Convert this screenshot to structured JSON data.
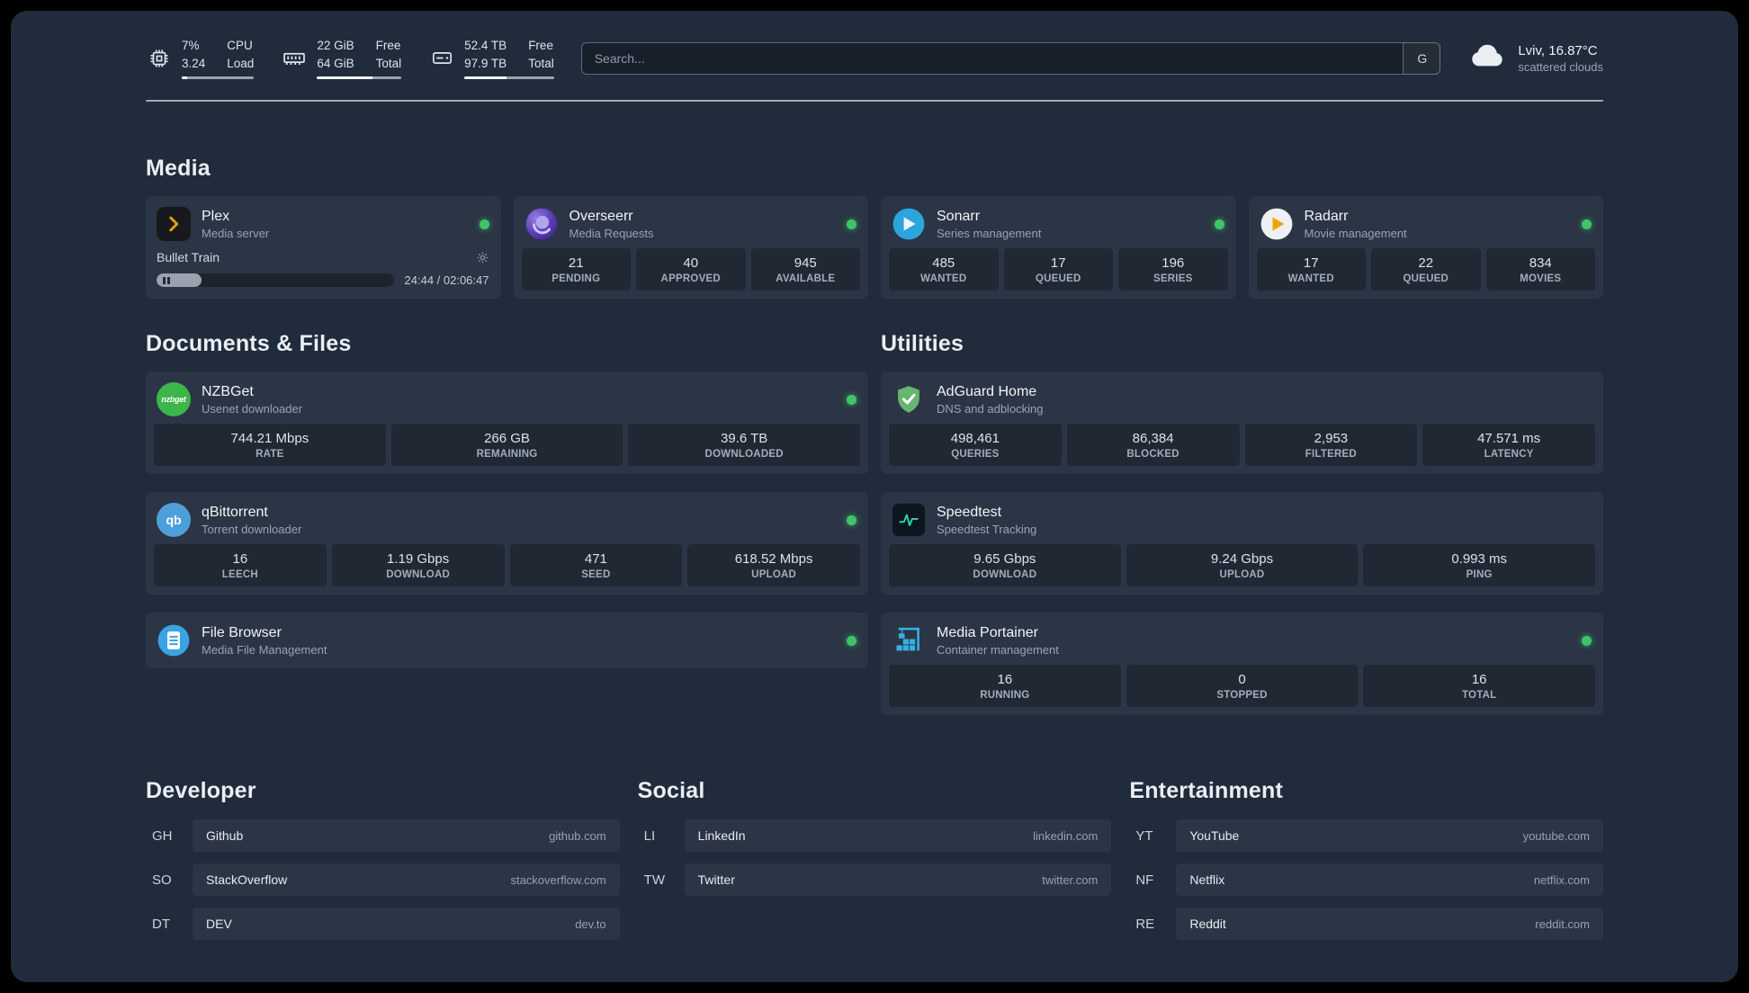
{
  "topbar": {
    "cpu": {
      "value_top": "7%",
      "value_bottom": "3.24",
      "label_top": "CPU",
      "label_bottom": "Load"
    },
    "memory": {
      "value_top": "22 GiB",
      "value_bottom": "64 GiB",
      "label_top": "Free",
      "label_bottom": "Total"
    },
    "disk": {
      "value_top": "52.4 TB",
      "value_bottom": "97.9 TB",
      "label_top": "Free",
      "label_bottom": "Total"
    },
    "search": {
      "placeholder": "Search...",
      "button_label": "G"
    },
    "weather": {
      "location": "Lviv, 16.87°C",
      "condition": "scattered clouds"
    }
  },
  "sections": {
    "media": {
      "title": "Media"
    },
    "documents": {
      "title": "Documents & Files"
    },
    "utilities": {
      "title": "Utilities"
    }
  },
  "services": {
    "plex": {
      "name": "Plex",
      "subtitle": "Media server",
      "player_title": "Bullet Train",
      "player_time": "24:44 / 02:06:47"
    },
    "overseerr": {
      "name": "Overseerr",
      "subtitle": "Media Requests",
      "stats": [
        {
          "value": "21",
          "label": "PENDING"
        },
        {
          "value": "40",
          "label": "APPROVED"
        },
        {
          "value": "945",
          "label": "AVAILABLE"
        }
      ]
    },
    "sonarr": {
      "name": "Sonarr",
      "subtitle": "Series management",
      "stats": [
        {
          "value": "485",
          "label": "WANTED"
        },
        {
          "value": "17",
          "label": "QUEUED"
        },
        {
          "value": "196",
          "label": "SERIES"
        }
      ]
    },
    "radarr": {
      "name": "Radarr",
      "subtitle": "Movie management",
      "stats": [
        {
          "value": "17",
          "label": "WANTED"
        },
        {
          "value": "22",
          "label": "QUEUED"
        },
        {
          "value": "834",
          "label": "MOVIES"
        }
      ]
    },
    "nzbget": {
      "name": "NZBGet",
      "subtitle": "Usenet downloader",
      "icon_text": "nzbget",
      "stats": [
        {
          "value": "744.21 Mbps",
          "label": "RATE"
        },
        {
          "value": "266 GB",
          "label": "REMAINING"
        },
        {
          "value": "39.6 TB",
          "label": "DOWNLOADED"
        }
      ]
    },
    "qbittorrent": {
      "name": "qBittorrent",
      "subtitle": "Torrent downloader",
      "icon_text": "qb",
      "stats": [
        {
          "value": "16",
          "label": "LEECH"
        },
        {
          "value": "1.19 Gbps",
          "label": "DOWNLOAD"
        },
        {
          "value": "471",
          "label": "SEED"
        },
        {
          "value": "618.52 Mbps",
          "label": "UPLOAD"
        }
      ]
    },
    "filebrowser": {
      "name": "File Browser",
      "subtitle": "Media File Management"
    },
    "adguard": {
      "name": "AdGuard Home",
      "subtitle": "DNS and adblocking",
      "stats": [
        {
          "value": "498,461",
          "label": "QUERIES"
        },
        {
          "value": "86,384",
          "label": "BLOCKED"
        },
        {
          "value": "2,953",
          "label": "FILTERED"
        },
        {
          "value": "47.571 ms",
          "label": "LATENCY"
        }
      ]
    },
    "speedtest": {
      "name": "Speedtest",
      "subtitle": "Speedtest Tracking",
      "stats": [
        {
          "value": "9.65 Gbps",
          "label": "DOWNLOAD"
        },
        {
          "value": "9.24 Gbps",
          "label": "UPLOAD"
        },
        {
          "value": "0.993 ms",
          "label": "PING"
        }
      ]
    },
    "portainer": {
      "name": "Media Portainer",
      "subtitle": "Container management",
      "stats": [
        {
          "value": "16",
          "label": "RUNNING"
        },
        {
          "value": "0",
          "label": "STOPPED"
        },
        {
          "value": "16",
          "label": "TOTAL"
        }
      ]
    }
  },
  "bookmarks": {
    "developer": {
      "title": "Developer",
      "items": [
        {
          "abbr": "GH",
          "name": "Github",
          "url": "github.com"
        },
        {
          "abbr": "SO",
          "name": "StackOverflow",
          "url": "stackoverflow.com"
        },
        {
          "abbr": "DT",
          "name": "DEV",
          "url": "dev.to"
        }
      ]
    },
    "social": {
      "title": "Social",
      "items": [
        {
          "abbr": "LI",
          "name": "LinkedIn",
          "url": "linkedin.com"
        },
        {
          "abbr": "TW",
          "name": "Twitter",
          "url": "twitter.com"
        }
      ]
    },
    "entertainment": {
      "title": "Entertainment",
      "items": [
        {
          "abbr": "YT",
          "name": "YouTube",
          "url": "youtube.com"
        },
        {
          "abbr": "NF",
          "name": "Netflix",
          "url": "netflix.com"
        },
        {
          "abbr": "RE",
          "name": "Reddit",
          "url": "reddit.com"
        }
      ]
    }
  },
  "colors": {
    "status_online": "#3fc46a",
    "plex_accent": "#e5a00d",
    "speedtest_accent": "#2fd6a5"
  }
}
